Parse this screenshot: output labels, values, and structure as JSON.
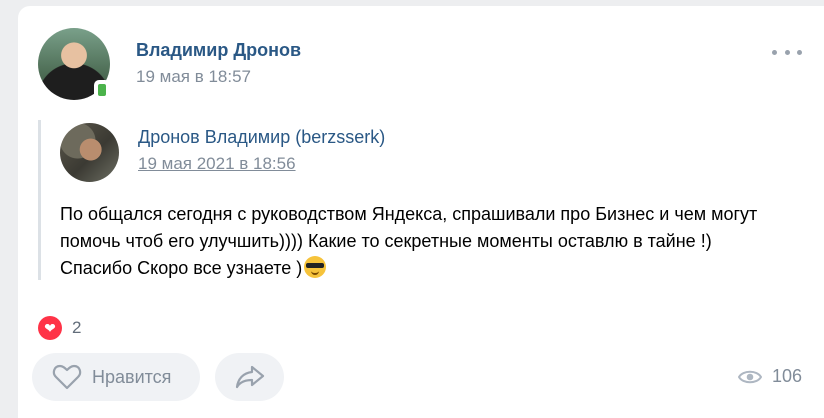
{
  "post": {
    "author_name": "Владимир Дронов",
    "date": "19 мая в 18:57"
  },
  "repost": {
    "author_name": "Дронов Владимир (berzsserk)",
    "date": "19 мая 2021 в 18:56",
    "text": "По общался сегодня с руководством Яндекса, спрашивали про Бизнес и чем могут помочь чтоб его улучшить)))) Какие то секретные моменты оставлю в тайне !) Спасибо Скоро все узнаете )"
  },
  "reactions": {
    "count": "2"
  },
  "actions": {
    "like_label": "Нравится"
  },
  "stats": {
    "views": "106"
  },
  "colors": {
    "link": "#2a5885",
    "muted": "#818c99",
    "heart": "#ff3347",
    "online": "#4bb34b"
  },
  "icons": [
    "online-phone-icon",
    "more-icon",
    "sunglasses-emoji-icon",
    "heart-reaction-icon",
    "heart-outline-icon",
    "share-icon",
    "eye-icon"
  ]
}
